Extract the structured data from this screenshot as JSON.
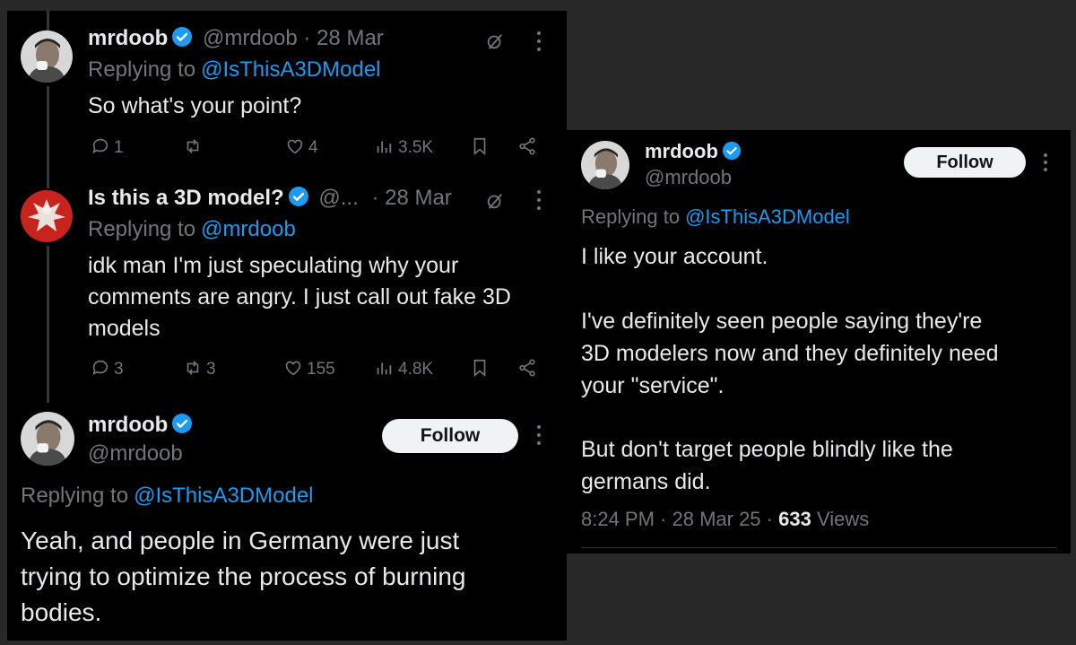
{
  "colors": {
    "accent": "#1d9bf0",
    "muted": "#71767b",
    "text": "#e7e9ea",
    "background": "#000000",
    "outer": "#282828"
  },
  "left": {
    "tweet1": {
      "name": "mrdoob",
      "handle": "@mrdoob",
      "date": "· 28 Mar",
      "replying_prefix": "Replying to",
      "replying_handle": "@IsThisA3DModel",
      "text": "So what's your point?",
      "actions": {
        "replies": "1",
        "retweets": "",
        "likes": "4",
        "views": "3.5K"
      }
    },
    "tweet2": {
      "name": "Is this a 3D model?",
      "handle": "@...",
      "date": "· 28 Mar",
      "replying_prefix": "Replying to",
      "replying_handle": "@mrdoob",
      "text_lines": [
        "idk man I'm just speculating why your",
        "comments are angry. I just call out fake 3D",
        "models"
      ],
      "actions": {
        "replies": "3",
        "retweets": "3",
        "likes": "155",
        "views": "4.8K"
      }
    },
    "tweet3": {
      "name": "mrdoob",
      "handle": "@mrdoob",
      "follow_label": "Follow",
      "replying_prefix": "Replying to",
      "replying_handle": "@IsThisA3DModel",
      "text_lines": [
        "Yeah, and people in Germany were just",
        "trying to optimize the process of burning",
        "bodies."
      ]
    }
  },
  "right": {
    "name": "mrdoob",
    "handle": "@mrdoob",
    "follow_label": "Follow",
    "replying_prefix": "Replying to",
    "replying_handle": "@IsThisA3DModel",
    "text_lines": [
      "I like your account.",
      "I've definitely seen people saying they're",
      "3D modelers now and they definitely need",
      "your \"service\".",
      "But don't target people blindly like the",
      "germans did."
    ],
    "time": "8:24 PM · 28 Mar 25 ·",
    "views_count": "633",
    "views_label": "Views"
  }
}
